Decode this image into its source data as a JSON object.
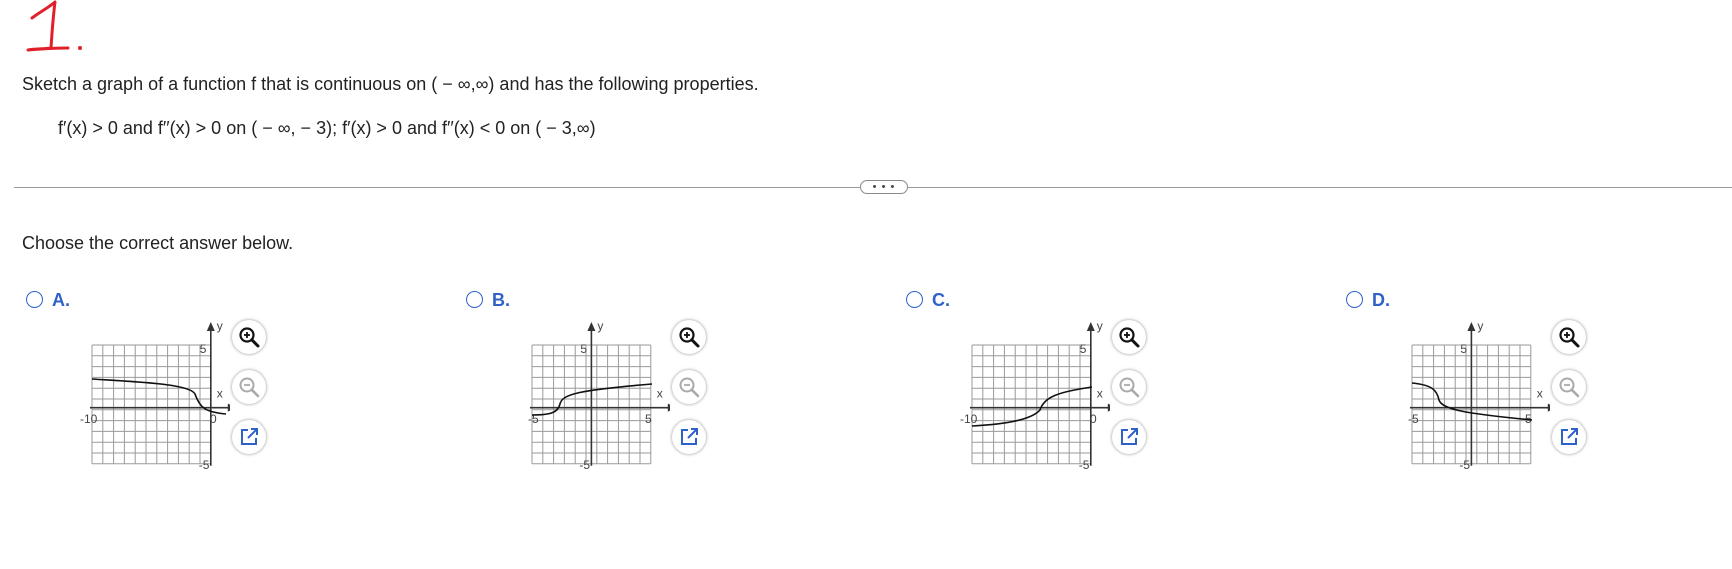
{
  "handwritten_number": "1.",
  "question": {
    "prompt": "Sketch a graph of a function f that is continuous on ( − ∞,∞) and has the following properties.",
    "conditions": "f′(x) > 0 and f′′(x) > 0 on ( − ∞, − 3); f′(x) > 0 and f′′(x) < 0 on ( − 3,∞)"
  },
  "more_button": "• • •",
  "instruction": "Choose the correct answer below.",
  "options": [
    {
      "letter": "A.",
      "tick_min": "-10",
      "tick_max": "0",
      "y_top": "5",
      "y_bottom": "-5",
      "x_axis_label": "x",
      "y_axis_label": "y"
    },
    {
      "letter": "B.",
      "tick_min": "-5",
      "tick_max": "5",
      "y_top": "5",
      "y_bottom": "-5",
      "x_axis_label": "x",
      "y_axis_label": "y"
    },
    {
      "letter": "C.",
      "tick_min": "-10",
      "tick_max": "0",
      "y_top": "5",
      "y_bottom": "-5",
      "x_axis_label": "x",
      "y_axis_label": "y"
    },
    {
      "letter": "D.",
      "tick_min": "-5",
      "tick_max": "5",
      "y_top": "5",
      "y_bottom": "-5",
      "x_axis_label": "x",
      "y_axis_label": "y"
    }
  ],
  "tools": {
    "zoom_in": "magnify-plus-icon",
    "zoom_out": "magnify-minus-icon",
    "popout": "popout-icon"
  },
  "colors": {
    "accent_blue": "#2f62c9",
    "handwriting_red": "#e0202a",
    "grid": "#9a9a9a",
    "curve": "#111111"
  }
}
